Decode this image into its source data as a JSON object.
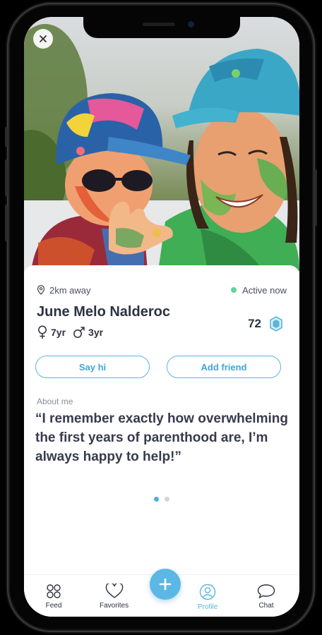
{
  "profile": {
    "distance": "2km away",
    "status": "Active now",
    "name": "June Melo Nalderoc",
    "kids": [
      {
        "gender": "female",
        "age": "7yr"
      },
      {
        "gender": "male",
        "age": "3yr"
      }
    ],
    "score": "72"
  },
  "actions": {
    "say_hi": "Say hi",
    "add_friend": "Add friend"
  },
  "about": {
    "label": "About me",
    "quote": "“I remember exactly how overwhelming the first years of parenthood are, I’m always happy to help!”"
  },
  "pager": {
    "count": 2,
    "active": 1
  },
  "tabs": {
    "feed": "Feed",
    "favorites": "Favorites",
    "profile": "Profile",
    "chat": "Chat"
  },
  "colors": {
    "accent": "#58b6e0",
    "active_dot": "#5fd69a",
    "text_dark": "#2e3142"
  },
  "icons": [
    "close-icon",
    "location-pin-icon",
    "female-icon",
    "male-icon",
    "badge-icon",
    "feed-icon",
    "heart-icon",
    "plus-icon",
    "profile-icon",
    "chat-icon"
  ]
}
